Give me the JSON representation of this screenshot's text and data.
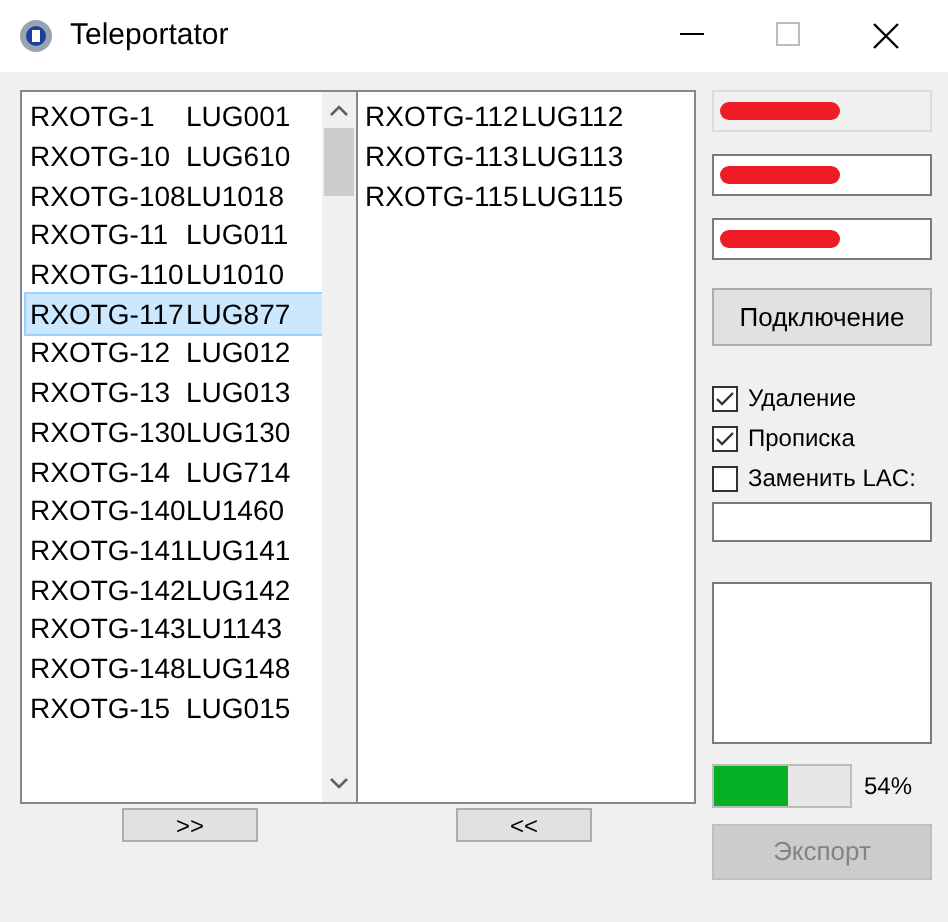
{
  "window": {
    "title": "Teleportator"
  },
  "left_list": [
    {
      "name": "RXOTG-1",
      "code": "LUG001",
      "selected": false
    },
    {
      "name": "RXOTG-10",
      "code": "LUG610",
      "selected": false
    },
    {
      "name": "RXOTG-108",
      "code": "LU1018",
      "selected": false
    },
    {
      "name": "RXOTG-11",
      "code": "LUG011",
      "selected": false
    },
    {
      "name": "RXOTG-110",
      "code": "LU1010",
      "selected": false
    },
    {
      "name": "RXOTG-117",
      "code": "LUG877",
      "selected": true
    },
    {
      "name": "RXOTG-12",
      "code": "LUG012",
      "selected": false
    },
    {
      "name": "RXOTG-13",
      "code": "LUG013",
      "selected": false
    },
    {
      "name": "RXOTG-130",
      "code": "LUG130",
      "selected": false
    },
    {
      "name": "RXOTG-14",
      "code": "LUG714",
      "selected": false
    },
    {
      "name": "RXOTG-140",
      "code": "LU1460",
      "selected": false
    },
    {
      "name": "RXOTG-141",
      "code": "LUG141",
      "selected": false
    },
    {
      "name": "RXOTG-142",
      "code": "LUG142",
      "selected": false
    },
    {
      "name": "RXOTG-143",
      "code": "LU1143",
      "selected": false
    },
    {
      "name": "RXOTG-148",
      "code": "LUG148",
      "selected": false
    },
    {
      "name": "RXOTG-15",
      "code": "LUG015",
      "selected": false
    }
  ],
  "right_list": [
    {
      "name": "RXOTG-112",
      "code": "LUG112",
      "selected": false
    },
    {
      "name": "RXOTG-113",
      "code": "LUG113",
      "selected": false
    },
    {
      "name": "RXOTG-115",
      "code": "LUG115",
      "selected": false
    }
  ],
  "move_right_button": ">>",
  "move_left_button": "<<",
  "fields": [
    {
      "kind": "readonly",
      "redacted": true
    },
    {
      "kind": "input",
      "redacted": true
    },
    {
      "kind": "input",
      "redacted": true
    }
  ],
  "connect_button": "Подключение",
  "checkboxes": [
    {
      "label": "Удаление",
      "checked": true
    },
    {
      "label": "Прописка",
      "checked": true
    },
    {
      "label": "Заменить LAC:",
      "checked": false
    }
  ],
  "progress": {
    "level": 0.54,
    "reading": "54%"
  },
  "export_button": {
    "label": "Экспорт",
    "disabled": true
  }
}
